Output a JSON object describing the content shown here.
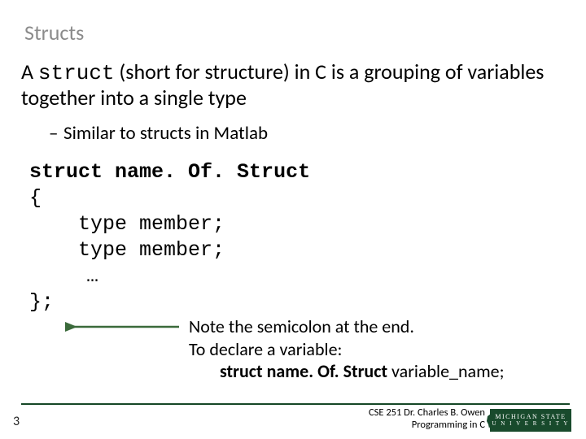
{
  "title": "Structs",
  "intro": {
    "pre": "A ",
    "kw": "struct",
    "post": " (short for structure) in C is a grouping of variables together into a single type"
  },
  "bullet": "Similar to structs in Matlab",
  "code": {
    "l1a": "struct",
    "l1b": "name. Of. Struct",
    "l2": "{",
    "l3": "type member;",
    "l4": "type member;",
    "l5": "…",
    "l6": "};"
  },
  "note": {
    "n1": "Note the semicolon at the end.",
    "n2": "To declare a variable:",
    "n3a": "struct name. Of. Struct",
    "n3b": " variable_name;"
  },
  "footer": {
    "page": "3",
    "credit1": "CSE 251 Dr. Charles B. Owen",
    "credit2": "Programming in C",
    "logo1": "MICHIGAN STATE",
    "logo2": "U N I V E R S I T Y"
  }
}
